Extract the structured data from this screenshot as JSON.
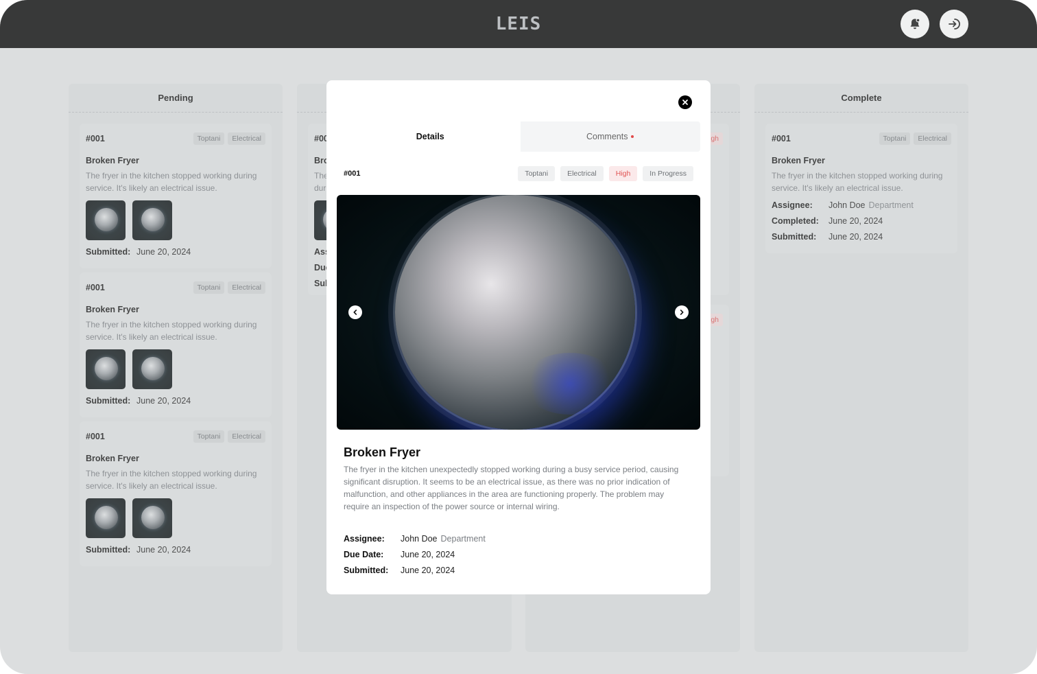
{
  "app": {
    "logo": "LEIS"
  },
  "columns": {
    "pending": {
      "title": "Pending"
    },
    "complete": {
      "title": "Complete"
    }
  },
  "pending_cards": [
    {
      "id": "#001",
      "tags": [
        "Toptani",
        "Electrical"
      ],
      "title": "Broken Fryer",
      "desc": "The fryer in the kitchen stopped working during service. It's likely an electrical issue.",
      "submitted_label": "Submitted:",
      "submitted": "June 20, 2024"
    },
    {
      "id": "#001",
      "tags": [
        "Toptani",
        "Electrical"
      ],
      "title": "Broken Fryer",
      "desc": "The fryer in the kitchen stopped working during service. It's likely an electrical issue.",
      "submitted_label": "Submitted:",
      "submitted": "June 20, 2024"
    },
    {
      "id": "#001",
      "tags": [
        "Toptani",
        "Electrical"
      ],
      "title": "Broken Fryer",
      "desc": "The fryer in the kitchen stopped working during service. It's likely an electrical issue.",
      "submitted_label": "Submitted:",
      "submitted": "June 20, 2024"
    }
  ],
  "partial_cards": {
    "col2_id": "#00",
    "col2_title": "Bro",
    "col2_desc1": "The",
    "col2_desc2": "dur",
    "col2_assignee": "Ass",
    "col2_due": "Due",
    "col2_sub": "Sub",
    "col3_tag": "gh"
  },
  "complete_card": {
    "id": "#001",
    "tags": [
      "Toptani",
      "Electrical"
    ],
    "title": "Broken Fryer",
    "desc": "The fryer in the kitchen stopped working during service. It's likely an electrical issue.",
    "assignee_label": "Assignee:",
    "assignee": "John Doe",
    "assignee_dept": "Department",
    "completed_label": "Completed:",
    "completed": "June 20, 2024",
    "submitted_label": "Submitted:",
    "submitted": "June 20, 2024"
  },
  "modal": {
    "tabs": {
      "details": "Details",
      "comments": "Comments"
    },
    "id": "#001",
    "tags": {
      "location": "Toptani",
      "category": "Electrical",
      "priority": "High",
      "status": "In Progress"
    },
    "title": "Broken Fryer",
    "description": "The fryer in the kitchen unexpectedly stopped working during a busy service period, causing significant disruption. It seems to be an electrical issue, as there was no prior indication of malfunction, and other appliances in the area are functioning properly. The problem may require an inspection of the power source or internal wiring.",
    "assignee_label": "Assignee:",
    "assignee": "John Doe",
    "assignee_dept": "Department",
    "due_label": "Due Date:",
    "due": "June 20, 2024",
    "submitted_label": "Submitted:",
    "submitted": "June 20, 2024"
  },
  "colors": {
    "topbar": "#000000",
    "priority_high": "#e05252",
    "notification_dot": "#e04848"
  },
  "icons": {
    "notifications": "bell-icon",
    "logout": "logout-icon",
    "close": "close-icon",
    "prev": "chevron-left-icon",
    "next": "chevron-right-icon"
  }
}
